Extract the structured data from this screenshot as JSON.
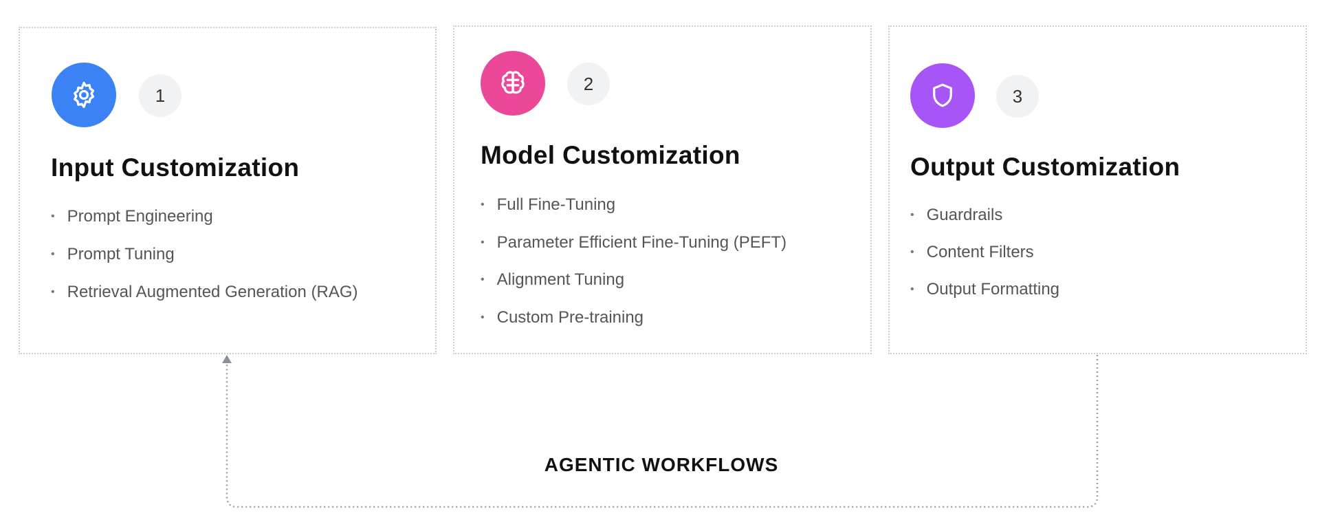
{
  "cards": [
    {
      "number": "1",
      "title": "Input Customization",
      "icon": "gear-icon",
      "color": "#3b82f6",
      "items": [
        "Prompt Engineering",
        "Prompt Tuning",
        "Retrieval Augmented Generation (RAG)"
      ]
    },
    {
      "number": "2",
      "title": "Model Customization",
      "icon": "brain-icon",
      "color": "#ec4899",
      "items": [
        "Full Fine-Tuning",
        "Parameter Efficient Fine-Tuning (PEFT)",
        "Alignment Tuning",
        "Custom Pre-training"
      ]
    },
    {
      "number": "3",
      "title": "Output Customization",
      "icon": "shield-icon",
      "color": "#a855f7",
      "items": [
        "Guardrails",
        "Content Filters",
        "Output Formatting"
      ]
    }
  ],
  "loop_label": "AGENTIC WORKFLOWS"
}
